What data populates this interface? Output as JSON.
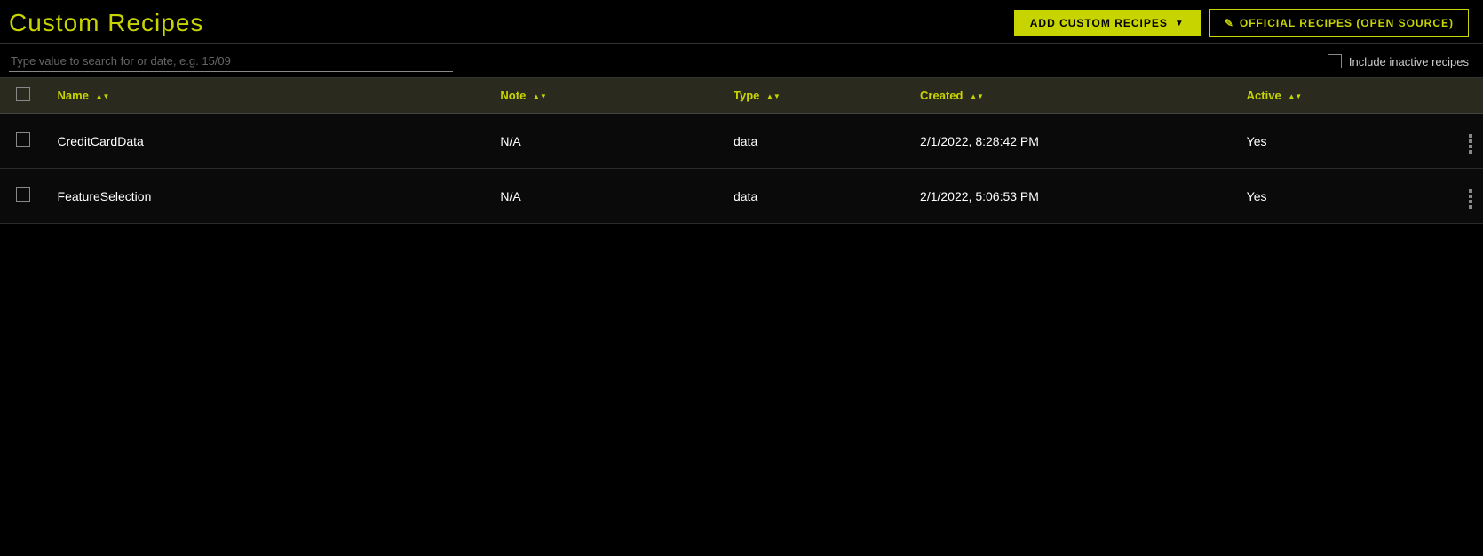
{
  "header": {
    "title": "Custom Recipes",
    "add_button_label": "ADD CUSTOM RECIPES",
    "official_button_label": "OFFICIAL RECIPES (OPEN SOURCE)",
    "pencil": "✎"
  },
  "toolbar": {
    "search_placeholder": "Type value to search for or date, e.g. 15/09",
    "include_inactive_label": "Include inactive recipes"
  },
  "table": {
    "columns": [
      {
        "key": "name",
        "label": "Name",
        "sortable": true
      },
      {
        "key": "note",
        "label": "Note",
        "sortable": true
      },
      {
        "key": "type",
        "label": "Type",
        "sortable": true
      },
      {
        "key": "created",
        "label": "Created",
        "sortable": true
      },
      {
        "key": "active",
        "label": "Active",
        "sortable": true
      }
    ],
    "rows": [
      {
        "name": "CreditCardData",
        "note": "N/A",
        "type": "data",
        "created": "2/1/2022, 8:28:42 PM",
        "active": "Yes"
      },
      {
        "name": "FeatureSelection",
        "note": "N/A",
        "type": "data",
        "created": "2/1/2022, 5:06:53 PM",
        "active": "Yes"
      }
    ]
  }
}
